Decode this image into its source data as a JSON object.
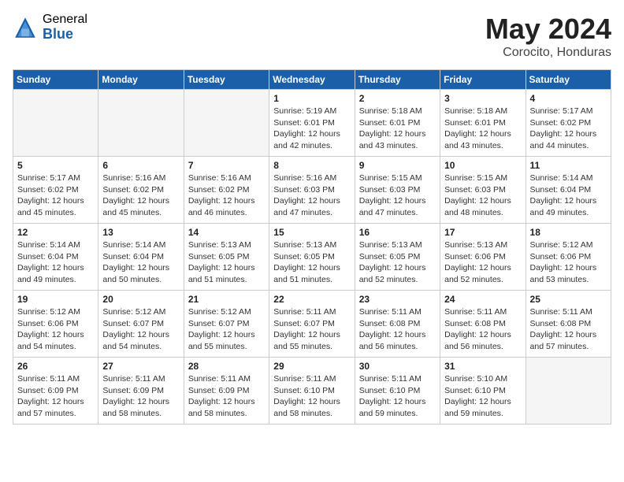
{
  "header": {
    "logo_general": "General",
    "logo_blue": "Blue",
    "month": "May 2024",
    "location": "Corocito, Honduras"
  },
  "days_of_week": [
    "Sunday",
    "Monday",
    "Tuesday",
    "Wednesday",
    "Thursday",
    "Friday",
    "Saturday"
  ],
  "weeks": [
    [
      {
        "day": "",
        "info": ""
      },
      {
        "day": "",
        "info": ""
      },
      {
        "day": "",
        "info": ""
      },
      {
        "day": "1",
        "info": "Sunrise: 5:19 AM\nSunset: 6:01 PM\nDaylight: 12 hours\nand 42 minutes."
      },
      {
        "day": "2",
        "info": "Sunrise: 5:18 AM\nSunset: 6:01 PM\nDaylight: 12 hours\nand 43 minutes."
      },
      {
        "day": "3",
        "info": "Sunrise: 5:18 AM\nSunset: 6:01 PM\nDaylight: 12 hours\nand 43 minutes."
      },
      {
        "day": "4",
        "info": "Sunrise: 5:17 AM\nSunset: 6:02 PM\nDaylight: 12 hours\nand 44 minutes."
      }
    ],
    [
      {
        "day": "5",
        "info": "Sunrise: 5:17 AM\nSunset: 6:02 PM\nDaylight: 12 hours\nand 45 minutes."
      },
      {
        "day": "6",
        "info": "Sunrise: 5:16 AM\nSunset: 6:02 PM\nDaylight: 12 hours\nand 45 minutes."
      },
      {
        "day": "7",
        "info": "Sunrise: 5:16 AM\nSunset: 6:02 PM\nDaylight: 12 hours\nand 46 minutes."
      },
      {
        "day": "8",
        "info": "Sunrise: 5:16 AM\nSunset: 6:03 PM\nDaylight: 12 hours\nand 47 minutes."
      },
      {
        "day": "9",
        "info": "Sunrise: 5:15 AM\nSunset: 6:03 PM\nDaylight: 12 hours\nand 47 minutes."
      },
      {
        "day": "10",
        "info": "Sunrise: 5:15 AM\nSunset: 6:03 PM\nDaylight: 12 hours\nand 48 minutes."
      },
      {
        "day": "11",
        "info": "Sunrise: 5:14 AM\nSunset: 6:04 PM\nDaylight: 12 hours\nand 49 minutes."
      }
    ],
    [
      {
        "day": "12",
        "info": "Sunrise: 5:14 AM\nSunset: 6:04 PM\nDaylight: 12 hours\nand 49 minutes."
      },
      {
        "day": "13",
        "info": "Sunrise: 5:14 AM\nSunset: 6:04 PM\nDaylight: 12 hours\nand 50 minutes."
      },
      {
        "day": "14",
        "info": "Sunrise: 5:13 AM\nSunset: 6:05 PM\nDaylight: 12 hours\nand 51 minutes."
      },
      {
        "day": "15",
        "info": "Sunrise: 5:13 AM\nSunset: 6:05 PM\nDaylight: 12 hours\nand 51 minutes."
      },
      {
        "day": "16",
        "info": "Sunrise: 5:13 AM\nSunset: 6:05 PM\nDaylight: 12 hours\nand 52 minutes."
      },
      {
        "day": "17",
        "info": "Sunrise: 5:13 AM\nSunset: 6:06 PM\nDaylight: 12 hours\nand 52 minutes."
      },
      {
        "day": "18",
        "info": "Sunrise: 5:12 AM\nSunset: 6:06 PM\nDaylight: 12 hours\nand 53 minutes."
      }
    ],
    [
      {
        "day": "19",
        "info": "Sunrise: 5:12 AM\nSunset: 6:06 PM\nDaylight: 12 hours\nand 54 minutes."
      },
      {
        "day": "20",
        "info": "Sunrise: 5:12 AM\nSunset: 6:07 PM\nDaylight: 12 hours\nand 54 minutes."
      },
      {
        "day": "21",
        "info": "Sunrise: 5:12 AM\nSunset: 6:07 PM\nDaylight: 12 hours\nand 55 minutes."
      },
      {
        "day": "22",
        "info": "Sunrise: 5:11 AM\nSunset: 6:07 PM\nDaylight: 12 hours\nand 55 minutes."
      },
      {
        "day": "23",
        "info": "Sunrise: 5:11 AM\nSunset: 6:08 PM\nDaylight: 12 hours\nand 56 minutes."
      },
      {
        "day": "24",
        "info": "Sunrise: 5:11 AM\nSunset: 6:08 PM\nDaylight: 12 hours\nand 56 minutes."
      },
      {
        "day": "25",
        "info": "Sunrise: 5:11 AM\nSunset: 6:08 PM\nDaylight: 12 hours\nand 57 minutes."
      }
    ],
    [
      {
        "day": "26",
        "info": "Sunrise: 5:11 AM\nSunset: 6:09 PM\nDaylight: 12 hours\nand 57 minutes."
      },
      {
        "day": "27",
        "info": "Sunrise: 5:11 AM\nSunset: 6:09 PM\nDaylight: 12 hours\nand 58 minutes."
      },
      {
        "day": "28",
        "info": "Sunrise: 5:11 AM\nSunset: 6:09 PM\nDaylight: 12 hours\nand 58 minutes."
      },
      {
        "day": "29",
        "info": "Sunrise: 5:11 AM\nSunset: 6:10 PM\nDaylight: 12 hours\nand 58 minutes."
      },
      {
        "day": "30",
        "info": "Sunrise: 5:11 AM\nSunset: 6:10 PM\nDaylight: 12 hours\nand 59 minutes."
      },
      {
        "day": "31",
        "info": "Sunrise: 5:10 AM\nSunset: 6:10 PM\nDaylight: 12 hours\nand 59 minutes."
      },
      {
        "day": "",
        "info": ""
      }
    ]
  ]
}
